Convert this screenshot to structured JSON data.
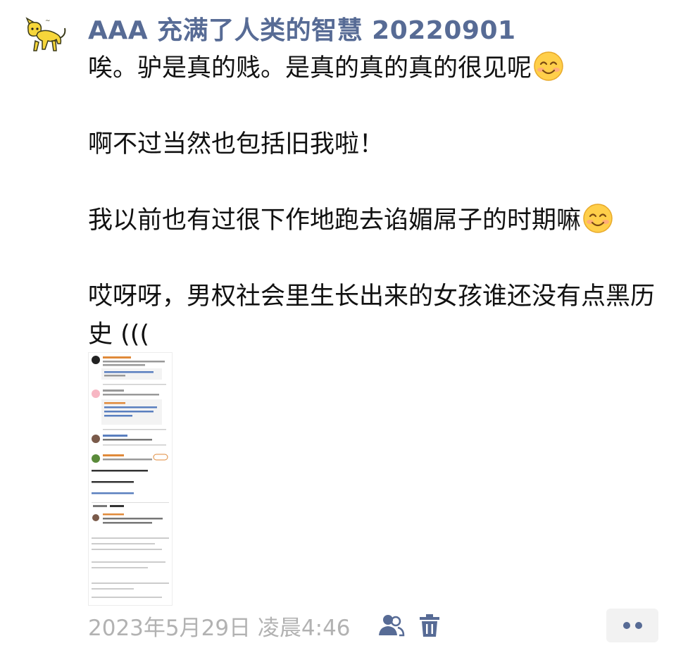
{
  "post": {
    "author": "AAA 充满了人类的智慧 20220901",
    "paragraphs": [
      {
        "text": "唉。驴是真的贱。是真的真的真的很见呢",
        "emoji": "smiling-face"
      },
      {
        "text": "啊不过当然也包括旧我啦！"
      },
      {
        "text": "我以前也有过很下作地跑去谄媚屌子的时期嘛",
        "emoji": "smiling-face"
      },
      {
        "text": "哎呀呀，男权社会里生长出来的女孩谁还没有点黑历史 ((("
      }
    ],
    "image": {
      "icon": "screenshot-thumbnail"
    }
  },
  "footer": {
    "timestamp": "2023年5月29日 凌晨4:46",
    "icons": [
      "visibility-people-icon",
      "delete-trash-icon",
      "more-dots-icon"
    ]
  },
  "colors": {
    "author": "#576b95",
    "text": "#111111",
    "meta": "#b2b2b2",
    "more_bg": "#f2f2f2"
  }
}
